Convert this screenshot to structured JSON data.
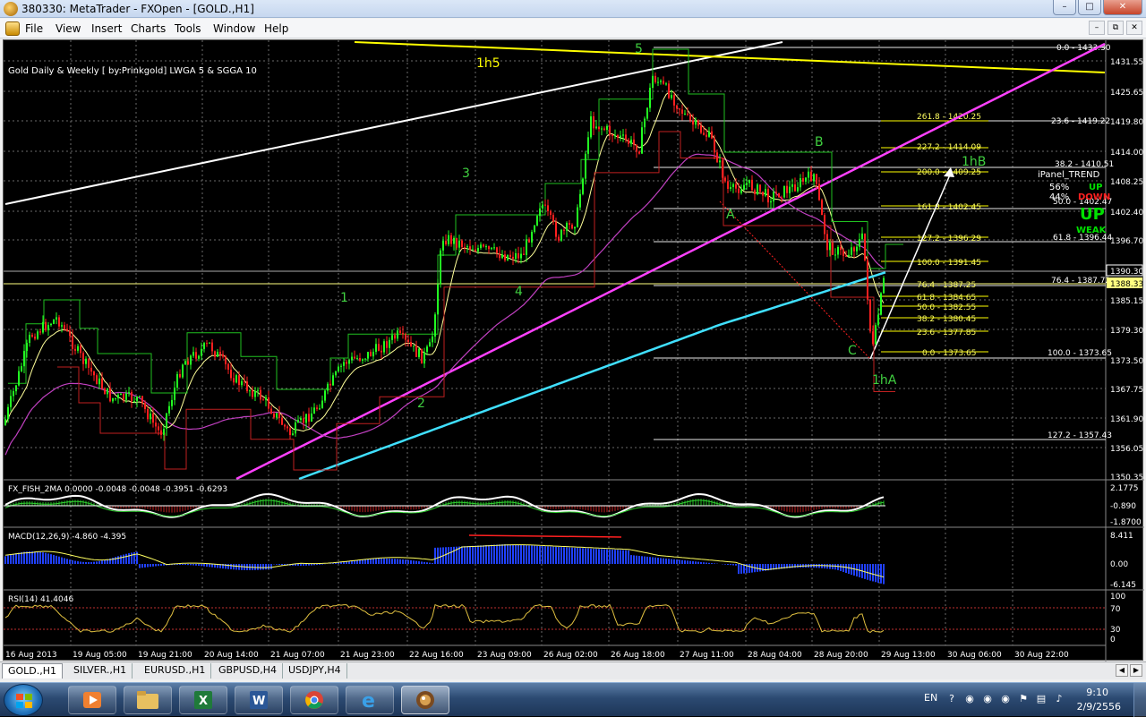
{
  "window": {
    "title": "380330: MetaTrader - FXOpen - [GOLD.,H1]"
  },
  "menu": [
    "File",
    "View",
    "Insert",
    "Charts",
    "Tools",
    "Window",
    "Help"
  ],
  "chart": {
    "header": "Gold Daily & Weekly [ by:Prinkgold] LWGA 5  &  SGGA 10",
    "price_ticks": [
      "1431.55",
      "1425.65",
      "1419.80",
      "1414.00",
      "1408.25",
      "1402.40",
      "1396.70",
      "1390.30",
      "1388.33",
      "1385.15",
      "1379.30",
      "1373.50",
      "1367.75",
      "1361.90",
      "1356.05",
      "1350.35"
    ],
    "current_price": "1390.30",
    "bid_price": "1388.33",
    "time_ticks": [
      "16 Aug 2013",
      "19 Aug 05:00",
      "19 Aug 21:00",
      "20 Aug 14:00",
      "21 Aug 07:00",
      "21 Aug 23:00",
      "22 Aug 16:00",
      "23 Aug 09:00",
      "26 Aug 02:00",
      "26 Aug 18:00",
      "27 Aug 11:00",
      "28 Aug 04:00",
      "28 Aug 20:00",
      "29 Aug 13:00",
      "30 Aug 06:00",
      "30 Aug 22:00"
    ],
    "wave_labels": [
      "1h5",
      "5",
      "3",
      "4",
      "1",
      "2",
      "A",
      "B",
      "C",
      "1hA",
      "1hB"
    ],
    "fib_levels_left": [
      "261.8 - 1420.25",
      "227.2 - 1414.09",
      "200.0 - 1409.25",
      "161.8 - 1402.45",
      "127.2 - 1396.29",
      "100.0 - 1391.45",
      "76.4 - 1387.25",
      "61.8 - 1384.65",
      "50.0 - 1382.55",
      "38.2 - 1380.45",
      "23.6 - 1377.85",
      "0.0 - 1373.65"
    ],
    "fib_levels_right": [
      "0.0 - 1433.30",
      "23.6 - 1419.22",
      "38.2 - 1410.51",
      "50.0 - 1402.47",
      "61.8 - 1396.44",
      "76.4 - 1387.72",
      "100.0 - 1373.65",
      "127.2 - 1357.43"
    ],
    "ipanel": {
      "title": "iPanel_TREND",
      "pct_up": "56%",
      "pct_down": "44%",
      "up_label": "UP",
      "down_label": "DOWN",
      "big_label": "UP",
      "strength": "WEAK"
    }
  },
  "fisher": {
    "header": "FX_FISH_2MA 0.0000 -0.0048 -0.0048 -0.3951 -0.6293",
    "ticks": [
      "2.1775",
      "-0.890",
      "-1.8700"
    ]
  },
  "macd": {
    "header": "MACD(12,26,9) -4.860 -4.395",
    "ticks": [
      "8.411",
      "0.00",
      "-6.145"
    ]
  },
  "rsi": {
    "header": "RSI(14) 41.4046",
    "ticks": [
      "100",
      "70",
      "30",
      "0"
    ]
  },
  "tabs": [
    "GOLD.,H1",
    "SILVER.,H1",
    "EURUSD.,H1",
    "GBPUSD,H4",
    "USDJPY,H4"
  ],
  "taskbar": {
    "lang": "EN",
    "time": "9:10",
    "date": "2/9/2556"
  },
  "colors": {
    "bull": "#22ff22",
    "bear": "#ff2020",
    "pink_trend": "#ff40ff",
    "cyan_ma": "#40e0ff",
    "yellow_line": "#ffff00"
  }
}
